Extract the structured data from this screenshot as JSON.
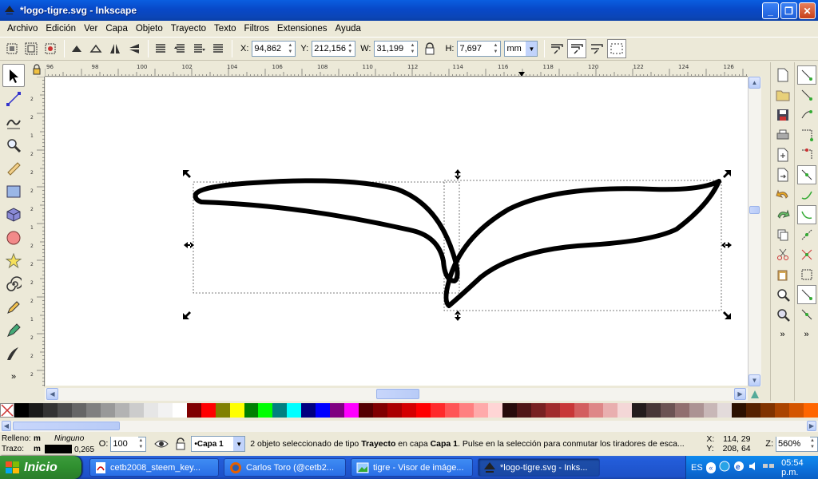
{
  "window": {
    "title": "*logo-tigre.svg - Inkscape"
  },
  "menu": [
    "Archivo",
    "Edición",
    "Ver",
    "Capa",
    "Objeto",
    "Trayecto",
    "Texto",
    "Filtros",
    "Extensiones",
    "Ayuda"
  ],
  "controls": {
    "x_label": "X:",
    "x_value": "94,862",
    "y_label": "Y:",
    "y_value": "212,156",
    "w_label": "W:",
    "w_value": "31,199",
    "h_label": "H:",
    "h_value": "7,697",
    "unit": "mm"
  },
  "ruler_top_labels": [
    "96",
    "98",
    "100",
    "102",
    "104",
    "106",
    "108",
    "110",
    "112",
    "114",
    "116",
    "118",
    "120",
    "122",
    "124",
    "126"
  ],
  "ruler_left_labels": [
    "2",
    "2",
    "1",
    "2",
    "2",
    "2",
    "2",
    "1",
    "2",
    "2",
    "2",
    "2",
    "1",
    "2",
    "2",
    "2"
  ],
  "palette": [
    "#000000",
    "#1a1a1a",
    "#333333",
    "#4d4d4d",
    "#666666",
    "#808080",
    "#999999",
    "#b3b3b3",
    "#cccccc",
    "#e6e6e6",
    "#f2f2f2",
    "#ffffff",
    "#800000",
    "#ff0000",
    "#808000",
    "#ffff00",
    "#008000",
    "#00ff00",
    "#008080",
    "#00ffff",
    "#000080",
    "#0000ff",
    "#800080",
    "#ff00ff",
    "#550000",
    "#800000",
    "#aa0000",
    "#d40000",
    "#ff0000",
    "#ff2a2a",
    "#ff5555",
    "#ff8080",
    "#ffaaaa",
    "#ffd5d5",
    "#280b0b",
    "#501616",
    "#782121",
    "#a02c2c",
    "#c83737",
    "#d35f5f",
    "#de8787",
    "#e9afaf",
    "#f4d7d7",
    "#241c1c",
    "#483737",
    "#6c5353",
    "#916f6f",
    "#ac9393",
    "#c8b7b7",
    "#e3dbdb",
    "#2b1100",
    "#552200",
    "#803300",
    "#aa4400",
    "#d45500",
    "#ff6600"
  ],
  "status": {
    "fill_label": "Relleno:",
    "fill_value": "m",
    "fill_none": "Ninguno",
    "stroke_label": "Trazo:",
    "stroke_value": "m",
    "stroke_width": "0,265",
    "opacity_label": "O:",
    "opacity_value": "100",
    "layer": "•Capa 1",
    "msg_prefix": "2 objeto seleccionado de tipo ",
    "msg_type": "Trayecto",
    "msg_mid": " en capa ",
    "msg_layer": "Capa 1",
    "msg_suffix": ". Pulse en la selección para conmutar los tiradores de esca...",
    "cx_label": "X:",
    "cx_value": "114, 29",
    "cy_label": "Y:",
    "cy_value": "208, 64",
    "zoom_label": "Z:",
    "zoom_value": "560%"
  },
  "taskbar": {
    "start": "Inicio",
    "tasks": [
      "cetb2008_steem_key...",
      "Carlos Toro (@cetb2...",
      "tigre - Visor de imáge...",
      "*logo-tigre.svg - Inks..."
    ],
    "lang": "ES",
    "clock": "05:54 p.m."
  }
}
